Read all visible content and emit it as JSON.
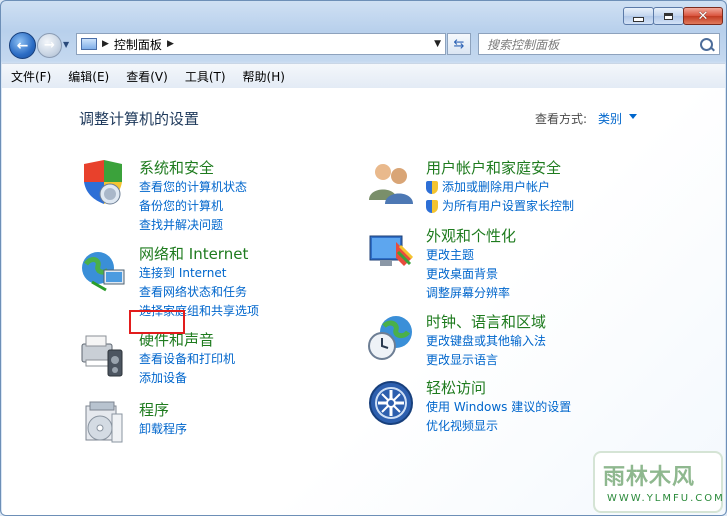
{
  "address": {
    "crumbs": [
      "控制面板"
    ]
  },
  "search": {
    "placeholder": "搜索控制面板"
  },
  "menu": [
    "文件(F)",
    "编辑(E)",
    "查看(V)",
    "工具(T)",
    "帮助(H)"
  ],
  "page": {
    "title": "调整计算机的设置",
    "view_label": "查看方式:",
    "view_value": "类别"
  },
  "categories_left": [
    {
      "title": "系统和安全",
      "icon": "system-security-icon",
      "links": [
        "查看您的计算机状态",
        "备份您的计算机",
        "查找并解决问题"
      ]
    },
    {
      "title": "网络和 Internet",
      "icon": "network-icon",
      "links": [
        "连接到 Internet",
        "查看网络状态和任务",
        "选择家庭组和共享选项"
      ]
    },
    {
      "title": "硬件和声音",
      "icon": "hardware-sound-icon",
      "links": [
        "查看设备和打印机",
        "添加设备"
      ]
    },
    {
      "title": "程序",
      "icon": "programs-icon",
      "links": [
        "卸载程序"
      ]
    }
  ],
  "categories_right": [
    {
      "title": "用户帐户和家庭安全",
      "icon": "user-accounts-icon",
      "links": [
        "添加或删除用户帐户",
        "为所有用户设置家长控制"
      ],
      "link_icons": [
        "uac-shield-icon",
        "uac-shield-icon"
      ]
    },
    {
      "title": "外观和个性化",
      "icon": "appearance-icon",
      "links": [
        "更改主题",
        "更改桌面背景",
        "调整屏幕分辨率"
      ]
    },
    {
      "title": "时钟、语言和区域",
      "icon": "clock-language-icon",
      "links": [
        "更改键盘或其他输入法",
        "更改显示语言"
      ]
    },
    {
      "title": "轻松访问",
      "icon": "ease-of-access-icon",
      "links": [
        "使用 Windows 建议的设置",
        "优化视频显示"
      ]
    }
  ],
  "watermark": {
    "top": "雨林木风",
    "bottom": "WWW.YLMFU.COM"
  },
  "colors": {
    "category_title": "#1e7b1e",
    "link": "#0066cc",
    "highlight": "#e21d1d"
  }
}
